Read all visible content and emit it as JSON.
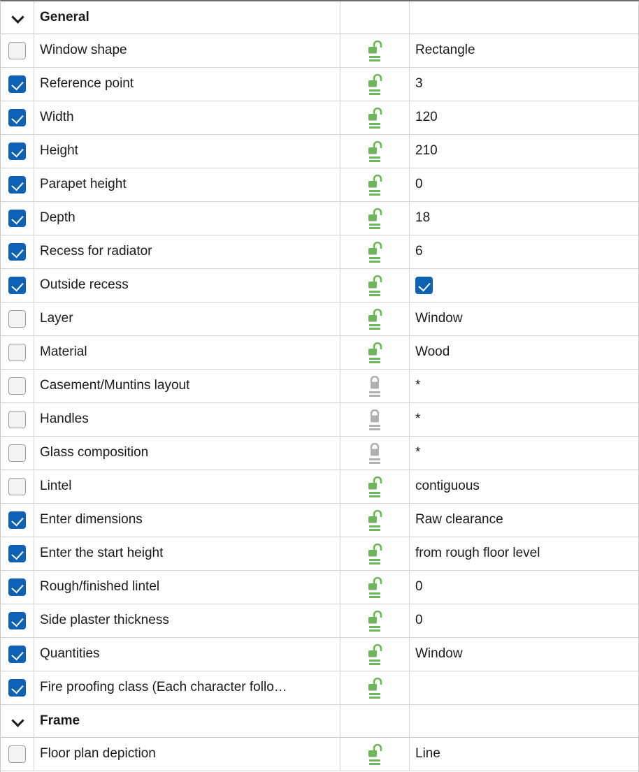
{
  "panel": {
    "name": "property-grid",
    "columns": [
      "select",
      "property",
      "lock",
      "value"
    ],
    "accent_checked": "#0d62b4",
    "accent_unlocked": "#6db65b",
    "accent_locked": "#b0b0b0",
    "text_color": "#1a1a1a",
    "border_color": "#d4d4d4"
  },
  "icons": {
    "chevron": "chevron-down-icon",
    "unlocked": "padlock-open-icon",
    "locked": "padlock-closed-icon",
    "checked": "checkbox-checked-icon",
    "unchecked": "checkbox-unchecked-icon"
  },
  "rows": [
    {
      "kind": "group",
      "label": "General",
      "checked": null,
      "lock": null,
      "value": "",
      "value_type": "text"
    },
    {
      "kind": "property",
      "label": "Window shape",
      "checked": false,
      "lock": "unlocked",
      "value": "Rectangle",
      "value_type": "text"
    },
    {
      "kind": "property",
      "label": "Reference point",
      "checked": true,
      "lock": "unlocked",
      "value": "3",
      "value_type": "text"
    },
    {
      "kind": "property",
      "label": "Width",
      "checked": true,
      "lock": "unlocked",
      "value": "120",
      "value_type": "text"
    },
    {
      "kind": "property",
      "label": "Height",
      "checked": true,
      "lock": "unlocked",
      "value": "210",
      "value_type": "text"
    },
    {
      "kind": "property",
      "label": "Parapet height",
      "checked": true,
      "lock": "unlocked",
      "value": "0",
      "value_type": "text"
    },
    {
      "kind": "property",
      "label": "Depth",
      "checked": true,
      "lock": "unlocked",
      "value": "18",
      "value_type": "text"
    },
    {
      "kind": "property",
      "label": "Recess for radiator",
      "checked": true,
      "lock": "unlocked",
      "value": "6",
      "value_type": "text"
    },
    {
      "kind": "property",
      "label": "Outside recess",
      "checked": true,
      "lock": "unlocked",
      "value": "",
      "value_type": "checkbox",
      "value_checked": true
    },
    {
      "kind": "property",
      "label": "Layer",
      "checked": false,
      "lock": "unlocked",
      "value": "Window",
      "value_type": "text"
    },
    {
      "kind": "property",
      "label": "Material",
      "checked": false,
      "lock": "unlocked",
      "value": "Wood",
      "value_type": "text"
    },
    {
      "kind": "property",
      "label": "Casement/Muntins layout",
      "checked": false,
      "lock": "locked",
      "value": "*",
      "value_type": "text"
    },
    {
      "kind": "property",
      "label": "Handles",
      "checked": false,
      "lock": "locked",
      "value": "*",
      "value_type": "text"
    },
    {
      "kind": "property",
      "label": "Glass composition",
      "checked": false,
      "lock": "locked",
      "value": "*",
      "value_type": "text"
    },
    {
      "kind": "property",
      "label": "Lintel",
      "checked": false,
      "lock": "unlocked",
      "value": "contiguous",
      "value_type": "text"
    },
    {
      "kind": "property",
      "label": "Enter dimensions",
      "checked": true,
      "lock": "unlocked",
      "value": "Raw clearance",
      "value_type": "text"
    },
    {
      "kind": "property",
      "label": "Enter the start height",
      "checked": true,
      "lock": "unlocked",
      "value": "from rough floor level",
      "value_type": "text"
    },
    {
      "kind": "property",
      "label": "Rough/finished lintel",
      "checked": true,
      "lock": "unlocked",
      "value": "0",
      "value_type": "text"
    },
    {
      "kind": "property",
      "label": "Side plaster thickness",
      "checked": true,
      "lock": "unlocked",
      "value": "0",
      "value_type": "text"
    },
    {
      "kind": "property",
      "label": "Quantities",
      "checked": true,
      "lock": "unlocked",
      "value": "Window",
      "value_type": "text"
    },
    {
      "kind": "property",
      "label": "Fire proofing class (Each character follo…",
      "checked": true,
      "lock": "unlocked",
      "value": "",
      "value_type": "text"
    },
    {
      "kind": "group",
      "label": "Frame",
      "checked": null,
      "lock": null,
      "value": "",
      "value_type": "text"
    },
    {
      "kind": "property",
      "label": "Floor plan depiction",
      "checked": false,
      "lock": "unlocked",
      "value": "Line",
      "value_type": "text"
    }
  ]
}
